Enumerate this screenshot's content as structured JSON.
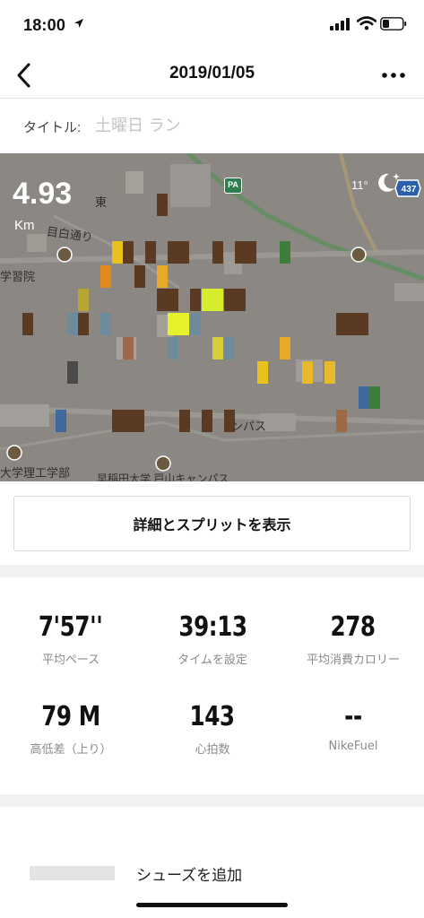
{
  "status_bar": {
    "time": "18:00"
  },
  "nav": {
    "title": "2019/01/05"
  },
  "title_row": {
    "label": "タイトル:",
    "placeholder": "土曜日 ラン"
  },
  "map": {
    "distance": "4.93",
    "distance_unit": "Km",
    "temperature": "11°",
    "road_number": "437",
    "parking_label": "PA",
    "labels": {
      "higashi": "東",
      "mejiro_dori": "目白通り",
      "gakushuin": "学習院",
      "campus": "ンパス",
      "science_faculty": "大学理工学部",
      "waseda_toyama": "早稲田大学 戸山キャンパス"
    }
  },
  "details_button": "詳細とスプリットを表示",
  "stats": [
    {
      "value": "7'57''",
      "label": "平均ペース"
    },
    {
      "value": "39:13",
      "label": "タイムを設定"
    },
    {
      "value": "278",
      "label": "平均消費カロリー"
    },
    {
      "value": "79 M",
      "label": "高低差（上り）"
    },
    {
      "value": "143",
      "label": "心拍数"
    },
    {
      "value": "--",
      "label": "NikeFuel"
    }
  ],
  "shoes": {
    "add_label": "シューズを追加"
  },
  "colors": {
    "map_overlay": "#8b8884",
    "road_green": "#2f7d4e",
    "route_yellow": "#e8c21c",
    "route_orange": "#e08a1e",
    "route_brown": "#5a3a22"
  }
}
